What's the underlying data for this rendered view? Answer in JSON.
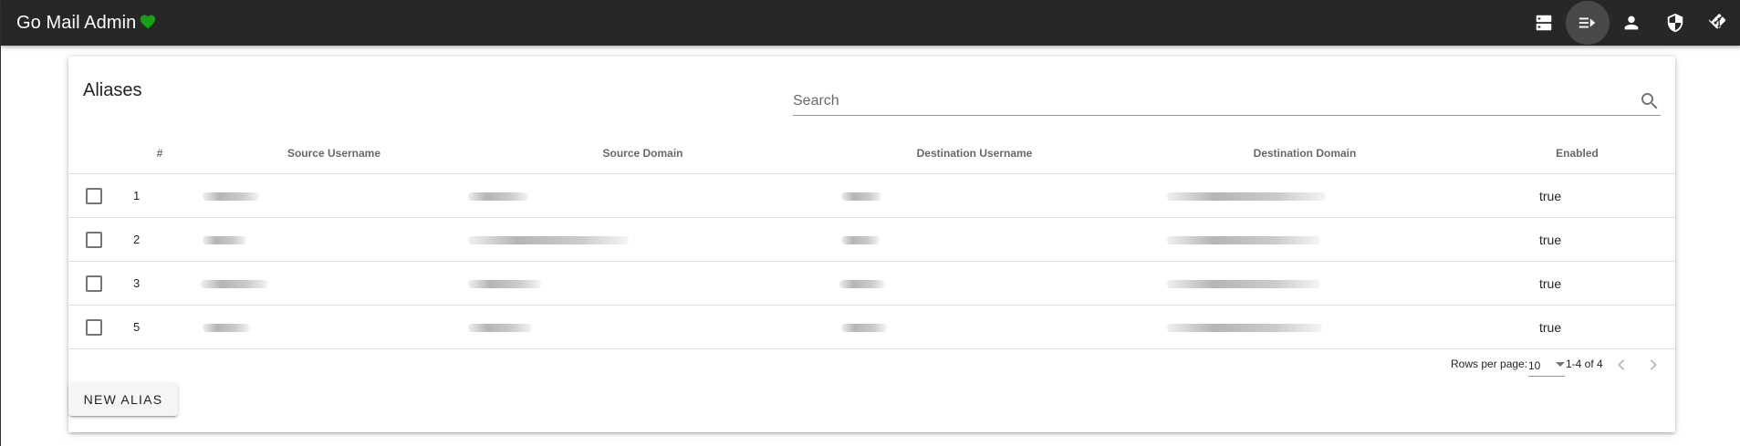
{
  "app": {
    "title": "Go Mail Admin",
    "heart_color": "#16a016"
  },
  "nav": [
    {
      "name": "domains-icon",
      "active": false
    },
    {
      "name": "aliases-icon",
      "active": true
    },
    {
      "name": "accounts-icon",
      "active": false
    },
    {
      "name": "tls-policy-icon",
      "active": false
    },
    {
      "name": "git-icon",
      "active": false
    }
  ],
  "aliases": {
    "title": "Aliases",
    "search_placeholder": "Search",
    "columns": [
      "#",
      "Source Username",
      "Source Domain",
      "Destination Username",
      "Destination Domain",
      "Enabled"
    ],
    "rows": [
      {
        "id": "1",
        "enabled": "true"
      },
      {
        "id": "2",
        "enabled": "true"
      },
      {
        "id": "3",
        "enabled": "true"
      },
      {
        "id": "5",
        "enabled": "true"
      }
    ],
    "footer": {
      "rows_per_page_label": "Rows per page:",
      "rows_per_page_value": "10",
      "range": "1-4 of 4"
    },
    "new_button": "NEW ALIAS"
  }
}
